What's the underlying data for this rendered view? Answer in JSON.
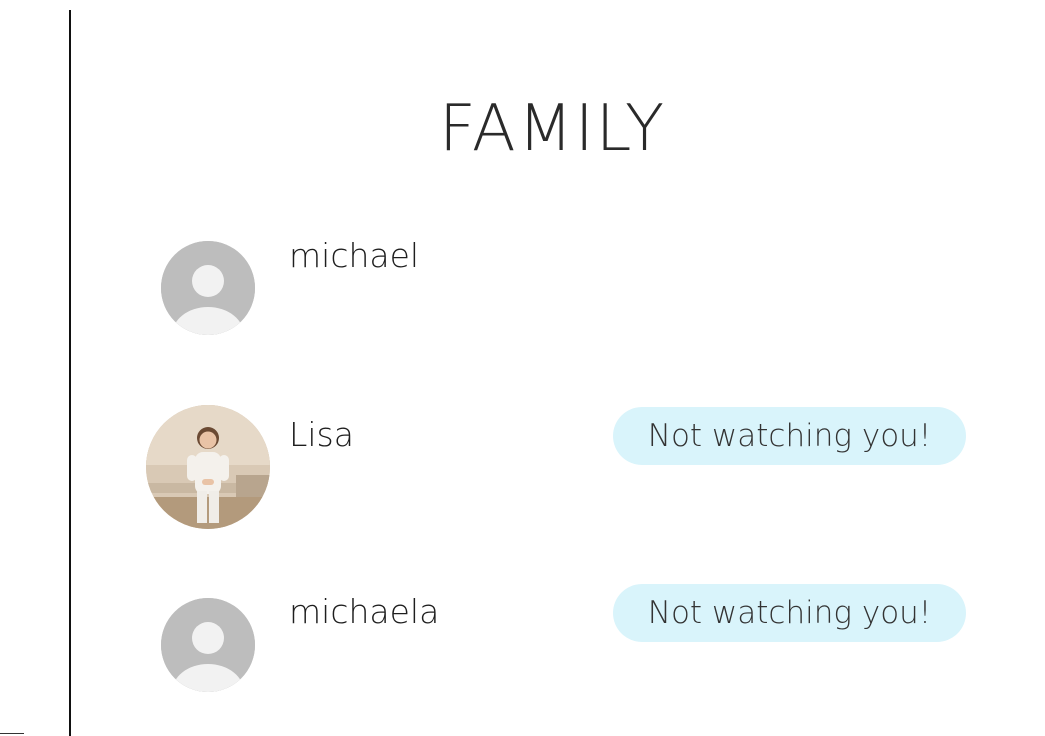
{
  "page": {
    "title": "FAMILY"
  },
  "members": [
    {
      "name": "michael",
      "avatar": "default-avatar-icon",
      "status": ""
    },
    {
      "name": "Lisa",
      "avatar": "photo",
      "status": "Not watching you!"
    },
    {
      "name": "michaela",
      "avatar": "default-avatar-icon",
      "status": "Not watching you!"
    }
  ],
  "colors": {
    "status_pill_bg": "#d9f4fb",
    "default_avatar_bg": "#bdbdbd",
    "divider": "#111111"
  }
}
